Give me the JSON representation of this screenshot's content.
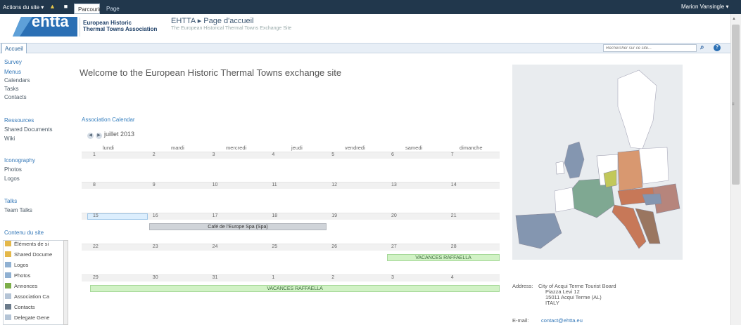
{
  "ribbon": {
    "site_actions": "Actions du site ▾",
    "tab_browse": "Parcourir",
    "tab_page": "Page",
    "user": "Marion Vansingle ▾"
  },
  "header": {
    "logo_word": "ehtta",
    "logo_name_line1": "European Historic",
    "logo_name_line2": "Thermal Towns Association",
    "breadcrumb": "EHTTA ▸ Page d'accueil",
    "subtitle": "The European Historical Thermal Towns Exchange Site"
  },
  "topnav": {
    "home_tab": "Accueil",
    "search_placeholder": "Rechercher sur ce site...",
    "search_icon": "search-icon",
    "help_icon": "help-icon"
  },
  "left_nav": {
    "survey": "Survey",
    "menus": "Menus",
    "calendars": "Calendars",
    "tasks": "Tasks",
    "contacts": "Contacts",
    "resources_heading": "Ressources",
    "shared_documents": "Shared Documents",
    "wiki": "Wiki",
    "iconography_heading": "Iconography",
    "photos": "Photos",
    "logos": "Logos",
    "talks_heading": "Talks",
    "team_talks": "Team Talks",
    "site_content_heading": "Contenu du site",
    "tree": [
      {
        "label": "Éléments de si",
        "icon": "folder-icon"
      },
      {
        "label": "Shared Docume",
        "icon": "folder-icon"
      },
      {
        "label": "Logos",
        "icon": "library-icon"
      },
      {
        "label": "Photos",
        "icon": "library-icon"
      },
      {
        "label": "Annonces",
        "icon": "announcement-icon"
      },
      {
        "label": "Association Ca",
        "icon": "calendar-list-icon"
      },
      {
        "label": "Contacts",
        "icon": "contacts-icon"
      },
      {
        "label": "Delegate Gene",
        "icon": "list-icon"
      }
    ]
  },
  "main": {
    "welcome": "Welcome to the European Historic Thermal Towns exchange site",
    "calendar_title": "Association Calendar",
    "month": "juillet 2013",
    "weekdays": [
      "lundi",
      "mardi",
      "mercredi",
      "jeudi",
      "vendredi",
      "samedi",
      "dimanche"
    ],
    "weeks": [
      [
        "1",
        "2",
        "3",
        "4",
        "5",
        "6",
        "7"
      ],
      [
        "8",
        "9",
        "10",
        "11",
        "12",
        "13",
        "14"
      ],
      [
        "15",
        "16",
        "17",
        "18",
        "19",
        "20",
        "21"
      ],
      [
        "22",
        "23",
        "24",
        "25",
        "26",
        "27",
        "28"
      ],
      [
        "29",
        "30",
        "31",
        "1",
        "2",
        "3",
        "4"
      ]
    ],
    "events": {
      "spa": "Café de l'Europe Spa (Spa)",
      "vacances_1": "VACANCES RAFFAELLA",
      "vacances_2": "VACANCES RAFFAELLA"
    }
  },
  "sidebar": {
    "address_label": "Address:",
    "address_lines": [
      "City of Acqui Terme Tourist Board",
      "Piazza Levi 12",
      "15011 Acqui Terme (AL)",
      "ITALY"
    ],
    "email_label": "E-mail:",
    "email": "contact@ehtta.eu"
  }
}
